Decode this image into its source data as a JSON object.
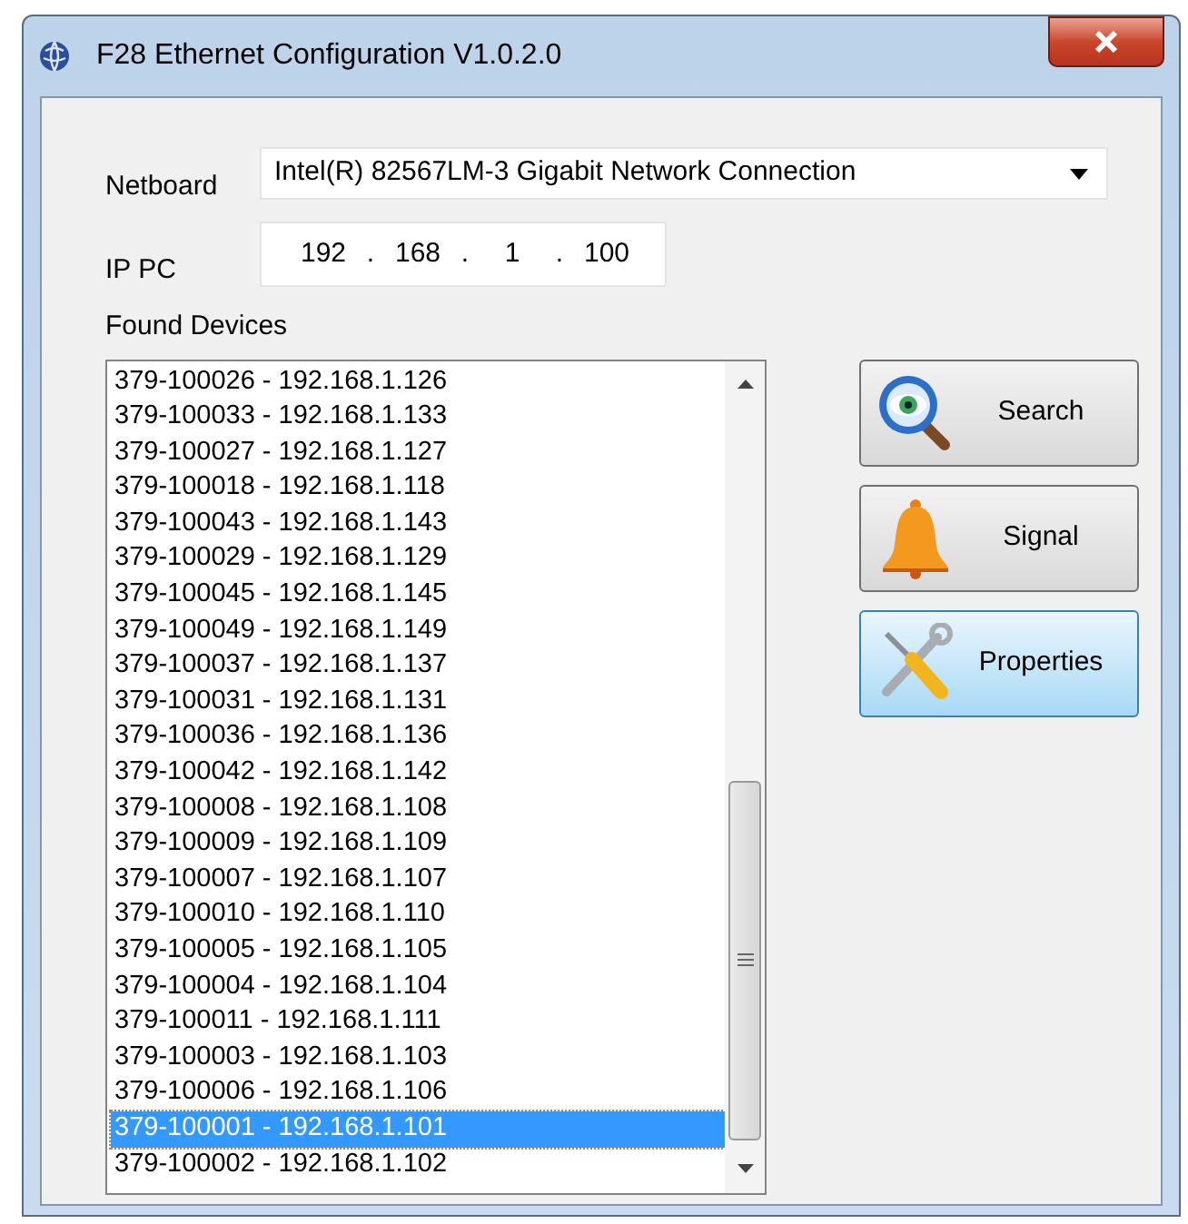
{
  "window": {
    "title": "F28 Ethernet Configuration V1.0.2.0"
  },
  "netboard": {
    "label": "Netboard",
    "value": "Intel(R) 82567LM-3 Gigabit Network Connection"
  },
  "ip_pc": {
    "label": "IP PC",
    "octets": [
      "192",
      "168",
      "1",
      "100"
    ],
    "separators": [
      ".",
      ".",
      "."
    ]
  },
  "found_devices": {
    "label": "Found Devices",
    "items": [
      {
        "text": "379-100026 - 192.168.1.126",
        "selected": false
      },
      {
        "text": "379-100033 - 192.168.1.133",
        "selected": false
      },
      {
        "text": "379-100027 - 192.168.1.127",
        "selected": false
      },
      {
        "text": "379-100018 - 192.168.1.118",
        "selected": false
      },
      {
        "text": "379-100043 - 192.168.1.143",
        "selected": false
      },
      {
        "text": "379-100029 - 192.168.1.129",
        "selected": false
      },
      {
        "text": "379-100045 - 192.168.1.145",
        "selected": false
      },
      {
        "text": "379-100049 - 192.168.1.149",
        "selected": false
      },
      {
        "text": "379-100037 - 192.168.1.137",
        "selected": false
      },
      {
        "text": "379-100031 - 192.168.1.131",
        "selected": false
      },
      {
        "text": "379-100036 - 192.168.1.136",
        "selected": false
      },
      {
        "text": "379-100042 - 192.168.1.142",
        "selected": false
      },
      {
        "text": "379-100008 - 192.168.1.108",
        "selected": false
      },
      {
        "text": "379-100009 - 192.168.1.109",
        "selected": false
      },
      {
        "text": "379-100007 - 192.168.1.107",
        "selected": false
      },
      {
        "text": "379-100010 - 192.168.1.110",
        "selected": false
      },
      {
        "text": "379-100005 - 192.168.1.105",
        "selected": false
      },
      {
        "text": "379-100004 - 192.168.1.104",
        "selected": false
      },
      {
        "text": "379-100011 - 192.168.1.111",
        "selected": false
      },
      {
        "text": "379-100003 - 192.168.1.103",
        "selected": false
      },
      {
        "text": "379-100006 - 192.168.1.106",
        "selected": false
      },
      {
        "text": "379-100001 - 192.168.1.101",
        "selected": true
      },
      {
        "text": "379-100002 - 192.168.1.102",
        "selected": false
      }
    ]
  },
  "buttons": [
    {
      "kind": "search",
      "label": "Search",
      "highlighted": false
    },
    {
      "kind": "signal",
      "label": "Signal",
      "highlighted": false
    },
    {
      "kind": "properties",
      "label": "Properties",
      "highlighted": true
    }
  ]
}
